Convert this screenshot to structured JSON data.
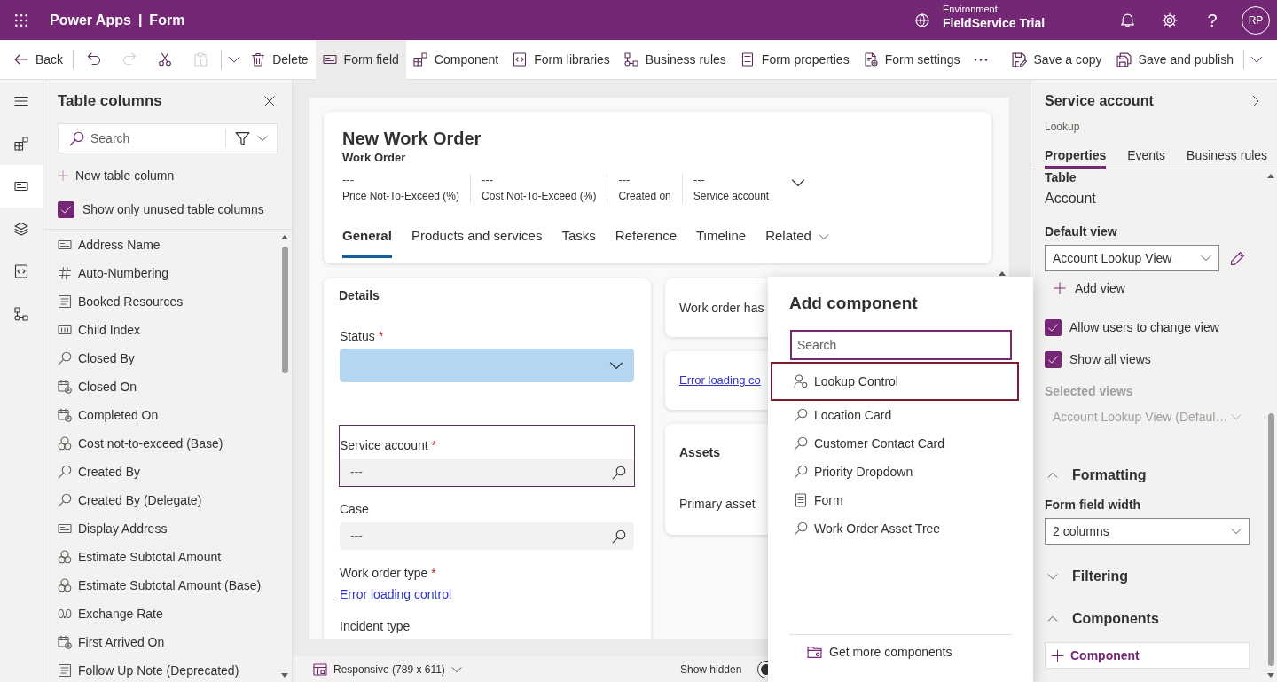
{
  "app_bar": {
    "product": "Power Apps",
    "separator": "|",
    "page": "Form",
    "environment_label": "Environment",
    "environment": "FieldService Trial",
    "help": "?",
    "avatar": "RP"
  },
  "toolbar": {
    "start": [
      [
        {
          "kind": "back",
          "label": "Back",
          "selected": false,
          "disabled": false
        }
      ],
      [
        {
          "kind": "undo",
          "selected": false,
          "disabled": false
        },
        {
          "kind": "redo",
          "selected": false,
          "disabled": true
        },
        {
          "kind": "cut",
          "selected": false,
          "disabled": false
        },
        {
          "kind": "paste",
          "selected": false,
          "disabled": true
        }
      ],
      [
        {
          "kind": "paste_options",
          "selected": false,
          "disabled": false
        },
        {
          "kind": "delete",
          "label": "Delete",
          "selected": false,
          "disabled": false
        },
        {
          "kind": "form_field",
          "label": "Form field",
          "selected": true,
          "disabled": false
        },
        {
          "kind": "component",
          "label": "Component",
          "selected": false,
          "disabled": false
        },
        {
          "kind": "form_libraries",
          "label": "Form libraries",
          "selected": false,
          "disabled": false
        },
        {
          "kind": "business_rules",
          "label": "Business rules",
          "selected": false,
          "disabled": false
        },
        {
          "kind": "form_properties",
          "label": "Form properties",
          "selected": false,
          "disabled": false
        },
        {
          "kind": "form_settings",
          "label": "Form settings",
          "selected": false,
          "disabled": false
        },
        {
          "kind": "more",
          "selected": false,
          "disabled": false
        }
      ]
    ],
    "end": [
      [
        {
          "kind": "save_copy",
          "label": "Save a copy",
          "selected": false,
          "disabled": false
        },
        {
          "kind": "save_publish",
          "label": "Save and publish",
          "selected": false,
          "disabled": false
        }
      ],
      [
        {
          "kind": "save_options",
          "selected": false,
          "disabled": false
        }
      ]
    ]
  },
  "rail": [
    {
      "kind": "menu",
      "selected": false
    },
    {
      "kind": "components",
      "selected": false
    },
    {
      "kind": "form_field",
      "selected": true
    },
    {
      "kind": "tree_view",
      "selected": false
    },
    {
      "kind": "form_libraries",
      "selected": false
    },
    {
      "kind": "business_rules",
      "selected": false
    }
  ],
  "columns_panel": {
    "title": "Table columns",
    "search": {
      "placeholder": "Search"
    },
    "new_column": "New table column",
    "unused_only": {
      "label": "Show only unused table columns",
      "checked": true
    },
    "columns": [
      {
        "kind": "text",
        "name": "Address Name"
      },
      {
        "kind": "autonumber",
        "name": "Auto-Numbering"
      },
      {
        "kind": "multiline",
        "name": "Booked Resources"
      },
      {
        "kind": "whole_number",
        "name": "Child Index"
      },
      {
        "kind": "lookup",
        "name": "Closed By"
      },
      {
        "kind": "datetime",
        "name": "Closed On"
      },
      {
        "kind": "datetime",
        "name": "Completed On"
      },
      {
        "kind": "currency",
        "name": "Cost not-to-exceed (Base)"
      },
      {
        "kind": "lookup",
        "name": "Created By"
      },
      {
        "kind": "lookup",
        "name": "Created By (Delegate)"
      },
      {
        "kind": "text",
        "name": "Display Address"
      },
      {
        "kind": "currency",
        "name": "Estimate Subtotal Amount"
      },
      {
        "kind": "currency",
        "name": "Estimate Subtotal Amount (Base)"
      },
      {
        "kind": "decimal",
        "name": "Exchange Rate"
      },
      {
        "kind": "datetime",
        "name": "First Arrived On"
      },
      {
        "kind": "multiline",
        "name": "Follow Up Note (Deprecated)"
      }
    ]
  },
  "form": {
    "title": "New Work Order",
    "subtitle": "Work Order",
    "header_fields": [
      {
        "value": "---",
        "label": "Price Not-To-Exceed (%)"
      },
      {
        "value": "---",
        "label": "Cost Not-To-Exceed (%)"
      },
      {
        "value": "---",
        "label": "Created on"
      },
      {
        "value": "---",
        "label": "Service account"
      }
    ],
    "tabs": [
      {
        "label": "General",
        "selected": true,
        "menu": false
      },
      {
        "label": "Products and services",
        "selected": false,
        "menu": false
      },
      {
        "label": "Tasks",
        "selected": false,
        "menu": false
      },
      {
        "label": "Reference",
        "selected": false,
        "menu": false
      },
      {
        "label": "Timeline",
        "selected": false,
        "menu": false
      },
      {
        "label": "Related",
        "selected": false,
        "menu": true
      }
    ],
    "details": {
      "title": "Details",
      "required_mark": "*",
      "fields": [
        {
          "kind": "choice",
          "label": "Status",
          "required": true,
          "selected": false
        },
        {
          "kind": "lookup",
          "label": "Service account",
          "required": true,
          "value": "---",
          "selected": true
        },
        {
          "kind": "lookup",
          "label": "Case",
          "required": false,
          "value": "---",
          "selected": false
        },
        {
          "kind": "error",
          "label": "Work order type",
          "required": true,
          "link": "Error loading control",
          "selected": false
        },
        {
          "kind": "label_only",
          "label": "Incident type",
          "required": false,
          "selected": false
        }
      ]
    },
    "side_cards": [
      {
        "kind": "text",
        "text": "Work order has"
      },
      {
        "kind": "link",
        "text": "Error loading co"
      },
      {
        "kind": "section",
        "title": "Assets",
        "field_label": "Primary asset"
      }
    ]
  },
  "canvas_footer": {
    "view": "Responsive (789 x 611)",
    "show_hidden": {
      "label": "Show hidden",
      "on": false
    }
  },
  "add_component": {
    "title": "Add component",
    "search": {
      "placeholder": "Search"
    },
    "items": [
      {
        "kind": "lookup",
        "label": "Lookup Control",
        "selected": true
      },
      {
        "kind": "custom",
        "label": "Location Card",
        "selected": false
      },
      {
        "kind": "custom",
        "label": "Customer Contact Card",
        "selected": false
      },
      {
        "kind": "custom",
        "label": "Priority Dropdown",
        "selected": false
      },
      {
        "kind": "form",
        "label": "Form",
        "selected": false
      },
      {
        "kind": "custom",
        "label": "Work Order Asset Tree",
        "selected": false
      }
    ],
    "more": "Get more components"
  },
  "properties": {
    "title": "Service account",
    "subtitle": "Lookup",
    "tabs": [
      {
        "label": "Properties",
        "selected": true
      },
      {
        "label": "Events",
        "selected": false
      },
      {
        "label": "Business rules",
        "selected": false
      }
    ],
    "table_label": "Table",
    "table": "Account",
    "default_view_label": "Default view",
    "default_view": "Account Lookup View",
    "add_view": "Add view",
    "options": [
      {
        "label": "Allow users to change view",
        "checked": true
      },
      {
        "label": "Show all views",
        "checked": true
      }
    ],
    "selected_views": {
      "label": "Selected views",
      "value": "Account Lookup View (Defaul…",
      "disabled": true
    },
    "sections": [
      {
        "title": "Formatting",
        "expanded": true,
        "field": {
          "label": "Form field width",
          "value": "2 columns"
        }
      },
      {
        "title": "Filtering",
        "expanded": false
      },
      {
        "title": "Components",
        "expanded": true,
        "button": "Component"
      }
    ]
  }
}
